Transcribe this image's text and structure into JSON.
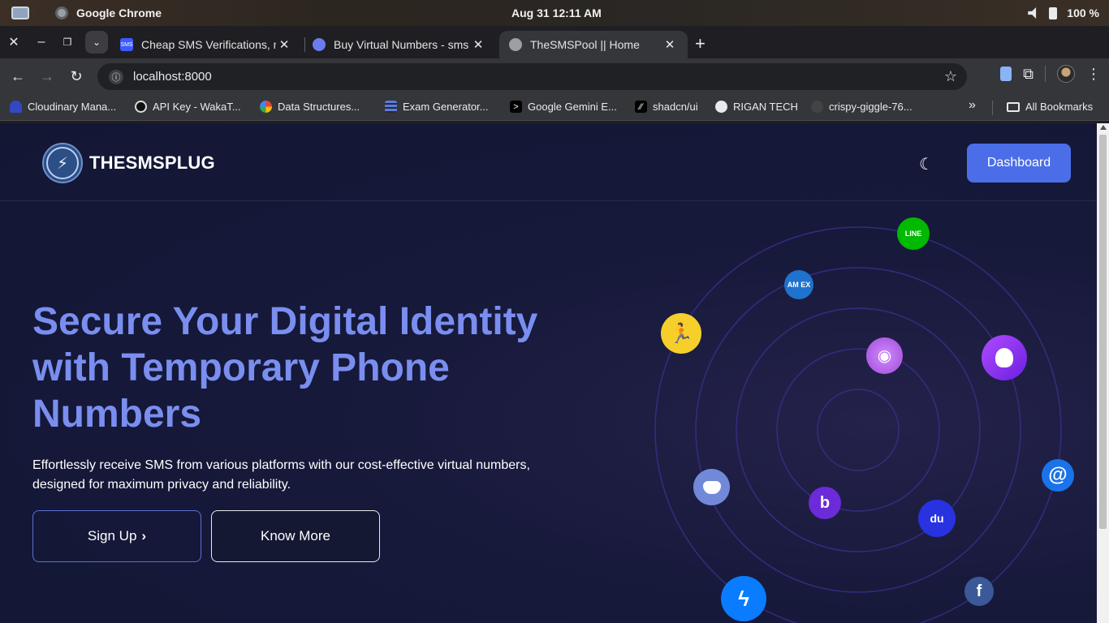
{
  "os": {
    "app_name": "Google Chrome",
    "clock": "Aug 31  12:11 AM",
    "battery": "100 %"
  },
  "tabs": [
    {
      "title": "Cheap SMS Verifications, n",
      "favicon_color": "#3d5afe",
      "favicon_text": "SMS"
    },
    {
      "title": "Buy Virtual Numbers - sms",
      "favicon_color": "#6a7cf0",
      "favicon_text": ""
    },
    {
      "title": "TheSMSPool || Home",
      "favicon_color": "#5f6368",
      "favicon_text": ""
    }
  ],
  "toolbar": {
    "url": "localhost:8000"
  },
  "bookmarks": [
    {
      "label": "Cloudinary Mana...",
      "color": "#3448c5"
    },
    {
      "label": "API Key - WakaT...",
      "color": "#111111"
    },
    {
      "label": "Data Structures...",
      "color": "#ea4335"
    },
    {
      "label": "Exam Generator...",
      "color": "#5b7be0"
    },
    {
      "label": "Google Gemini E...",
      "color": "#000000"
    },
    {
      "label": "shadcn/ui",
      "color": "#000000"
    },
    {
      "label": "RIGAN TECH",
      "color": "#e8eaed"
    },
    {
      "label": "crispy-giggle-76...",
      "color": "#444444"
    }
  ],
  "bookmarks_more": "»",
  "all_bookmarks": "All Bookmarks",
  "site": {
    "brand": "THESMSPLUG",
    "dashboard_label": "Dashboard",
    "hero_title": "Secure Your Digital Identity with Temporary Phone Numbers",
    "hero_subtitle": "Effortlessly receive SMS from various platforms with our cost-effective virtual numbers, designed for maximum privacy and reliability.",
    "signup_label": "Sign Up",
    "know_more_label": "Know More"
  },
  "colors": {
    "accent": "#4b6ee8",
    "hero_title": "#7a8ef0",
    "page_bg": "#16193a"
  },
  "orbit_icons": [
    {
      "name": "line-icon",
      "label": "LINE",
      "color": "#00b900"
    },
    {
      "name": "amex-icon",
      "label": "AM EX",
      "color": "#1f72cd"
    },
    {
      "name": "aim-icon",
      "label": "",
      "color": "#f7cf2b"
    },
    {
      "name": "podcasts-icon",
      "label": "",
      "color": "#9f49d6"
    },
    {
      "name": "alice-icon",
      "label": "",
      "color": "#7b2ff2"
    },
    {
      "name": "discord-icon",
      "label": "",
      "color": "#7289da"
    },
    {
      "name": "badoo-icon",
      "label": "b",
      "color": "#6c2bd9"
    },
    {
      "name": "baidu-icon",
      "label": "du",
      "color": "#2932e1"
    },
    {
      "name": "at-sign-icon",
      "label": "@",
      "color": "#1a73e8"
    },
    {
      "name": "messenger-icon",
      "label": "",
      "color": "#0a7cff"
    },
    {
      "name": "facebook-icon",
      "label": "f",
      "color": "#3b5998"
    }
  ]
}
